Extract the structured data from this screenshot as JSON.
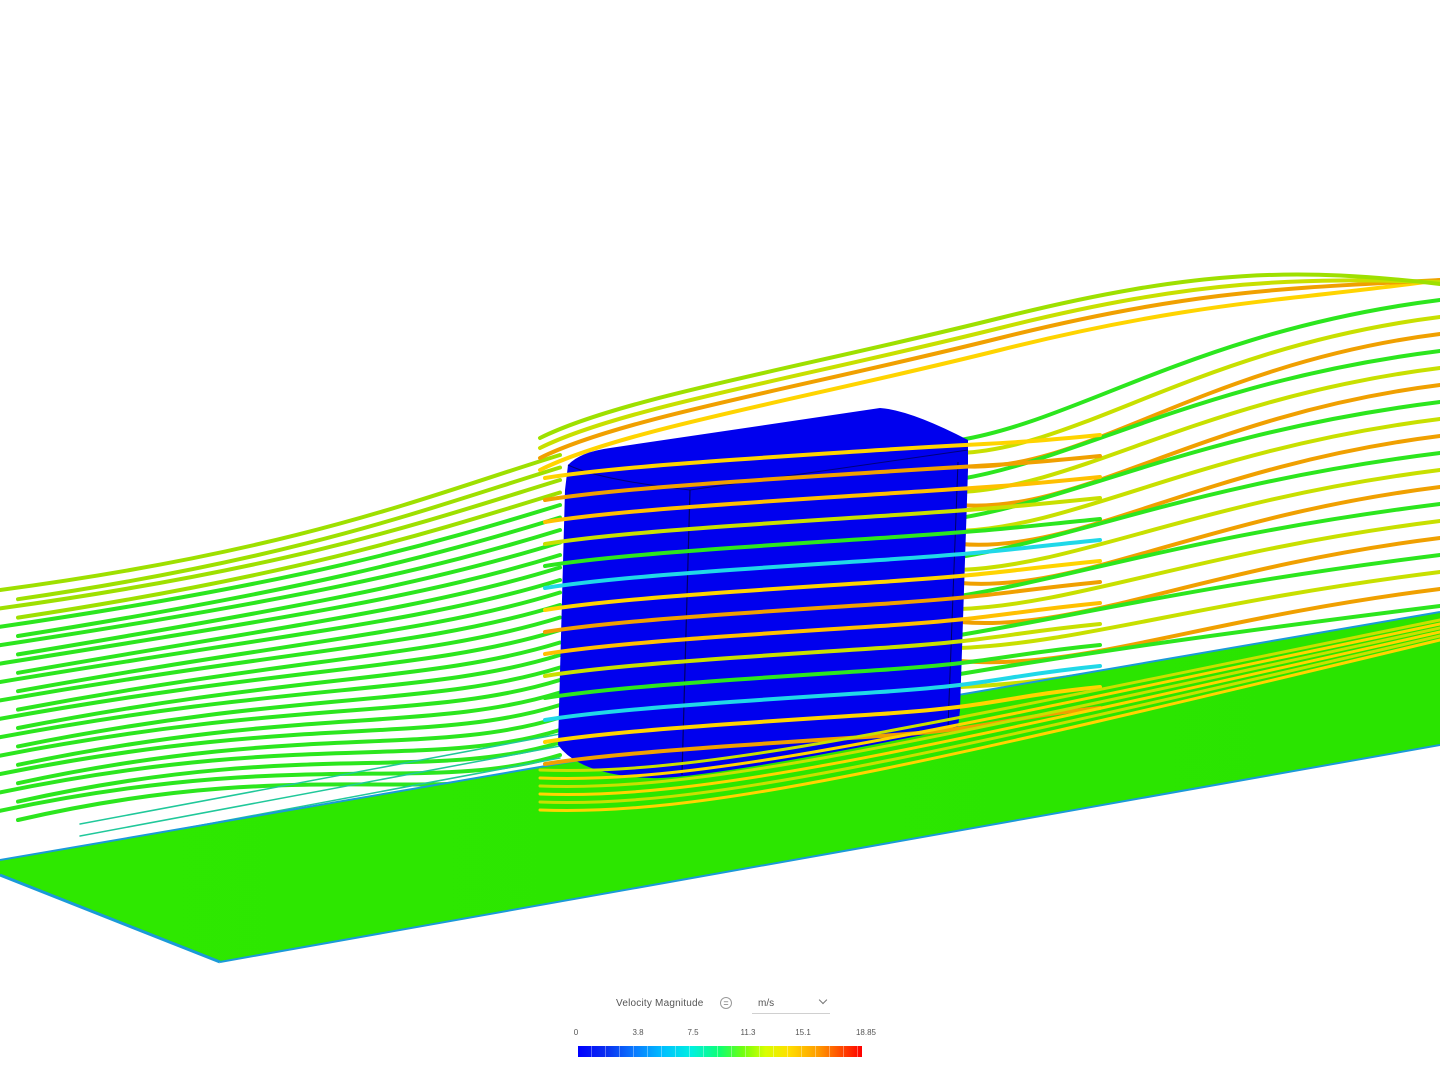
{
  "legend": {
    "title": "Velocity Magnitude",
    "menu_icon": "equals-icon",
    "unit": "m/s",
    "ticks": [
      "0",
      "3.8",
      "7.5",
      "11.3",
      "15.1",
      "18.85"
    ],
    "range": [
      0,
      18.85
    ]
  },
  "colors": {
    "body": "#0000ee",
    "floor": "#2ce600",
    "streamline_low": "#2ce61e",
    "streamline_high": "#ffd000"
  },
  "viewport": {
    "icon": "3d-viewport"
  }
}
